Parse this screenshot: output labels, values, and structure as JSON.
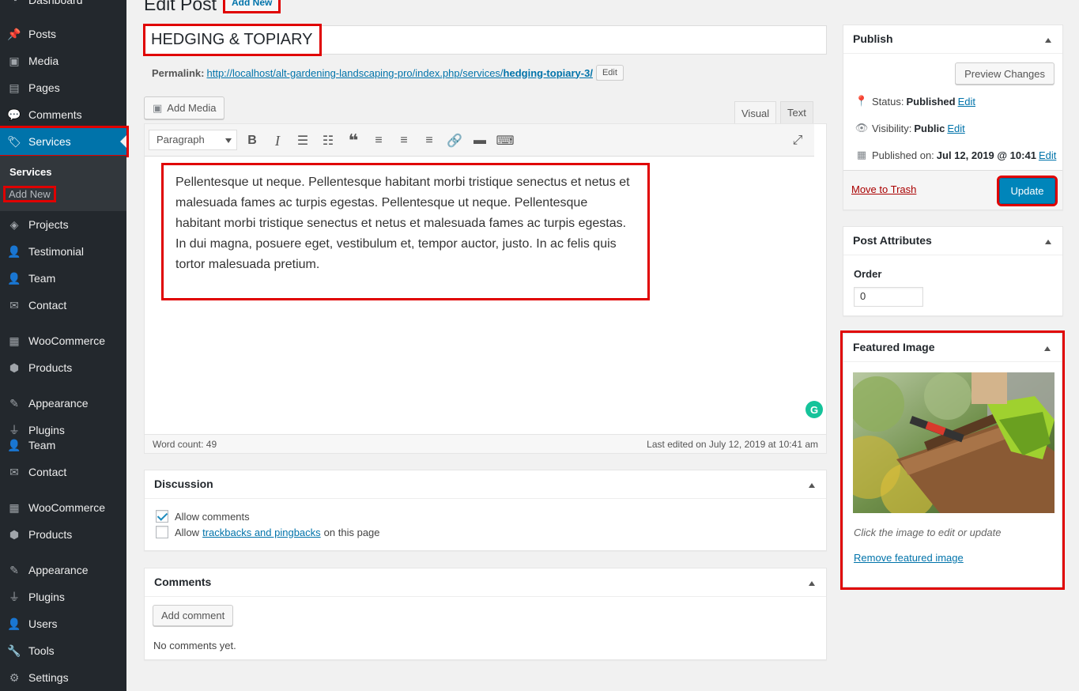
{
  "sidebar": {
    "items": [
      {
        "label": "Dashboard",
        "icon": "dashboard-icon"
      },
      {
        "label": "Posts",
        "icon": "pin-icon"
      },
      {
        "label": "Media",
        "icon": "media-icon"
      },
      {
        "label": "Pages",
        "icon": "pages-icon"
      },
      {
        "label": "Comments",
        "icon": "comment-icon"
      },
      {
        "label": "Services",
        "icon": "tag-icon"
      },
      {
        "label": "Projects",
        "icon": "portfolio-icon"
      },
      {
        "label": "Testimonial",
        "icon": "user-icon"
      },
      {
        "label": "Team",
        "icon": "user-icon"
      },
      {
        "label": "Contact",
        "icon": "envelope-icon"
      },
      {
        "label": "WooCommerce",
        "icon": "woo-icon"
      },
      {
        "label": "Products",
        "icon": "box-icon"
      },
      {
        "label": "Appearance",
        "icon": "brush-icon"
      },
      {
        "label": "Plugins",
        "icon": "plug-icon"
      },
      {
        "label": "Team",
        "icon": "user-icon"
      },
      {
        "label": "Contact",
        "icon": "envelope-icon"
      },
      {
        "label": "WooCommerce",
        "icon": "woo-icon"
      },
      {
        "label": "Products",
        "icon": "box-icon"
      },
      {
        "label": "Appearance",
        "icon": "brush-icon"
      },
      {
        "label": "Plugins",
        "icon": "plug-icon"
      },
      {
        "label": "Users",
        "icon": "user-icon"
      },
      {
        "label": "Tools",
        "icon": "wrench-icon"
      },
      {
        "label": "Settings",
        "icon": "settings-icon"
      }
    ],
    "submenu": {
      "current": "Services",
      "add_new": "Add New"
    }
  },
  "header": {
    "title": "Edit Post",
    "add_new": "Add New"
  },
  "post": {
    "title": "HEDGING & TOPIARY",
    "permalink_label": "Permalink:",
    "permalink_base": "http://localhost/alt-gardening-landscaping-pro/index.php/services/",
    "permalink_slug": "hedging-topiary-3/",
    "permalink_edit": "Edit"
  },
  "editor": {
    "add_media": "Add Media",
    "tab_visual": "Visual",
    "tab_text": "Text",
    "format": "Paragraph",
    "content": "Pellentesque ut neque. Pellentesque habitant morbi tristique senectus et netus et malesuada fames ac turpis egestas. Pellentesque ut neque. Pellentesque habitant morbi tristique senectus et netus et malesuada fames ac turpis egestas. In dui magna, posuere eget, vestibulum et, tempor auctor, justo. In ac felis quis tortor malesuada pretium.",
    "word_count": "Word count: 49",
    "last_edited": "Last edited on July 12, 2019 at 10:41 am"
  },
  "discussion": {
    "title": "Discussion",
    "allow_comments": "Allow comments",
    "allow_prefix": "Allow",
    "trackbacks_link": "trackbacks and pingbacks",
    "allow_suffix": "on this page"
  },
  "comments_box": {
    "title": "Comments",
    "add_button": "Add comment",
    "empty": "No comments yet."
  },
  "publish": {
    "title": "Publish",
    "preview": "Preview Changes",
    "status_label": "Status:",
    "status_value": "Published",
    "visibility_label": "Visibility:",
    "visibility_value": "Public",
    "published_label": "Published on:",
    "published_value": "Jul 12, 2019 @ 10:41",
    "edit": "Edit",
    "trash": "Move to Trash",
    "update": "Update"
  },
  "attributes": {
    "title": "Post Attributes",
    "order_label": "Order",
    "order_value": "0"
  },
  "featured": {
    "title": "Featured Image",
    "caption": "Click the image to edit or update",
    "remove": "Remove featured image"
  },
  "colors": {
    "accent": "#0073aa",
    "sidebar": "#23282d",
    "highlight": "#e00000"
  }
}
